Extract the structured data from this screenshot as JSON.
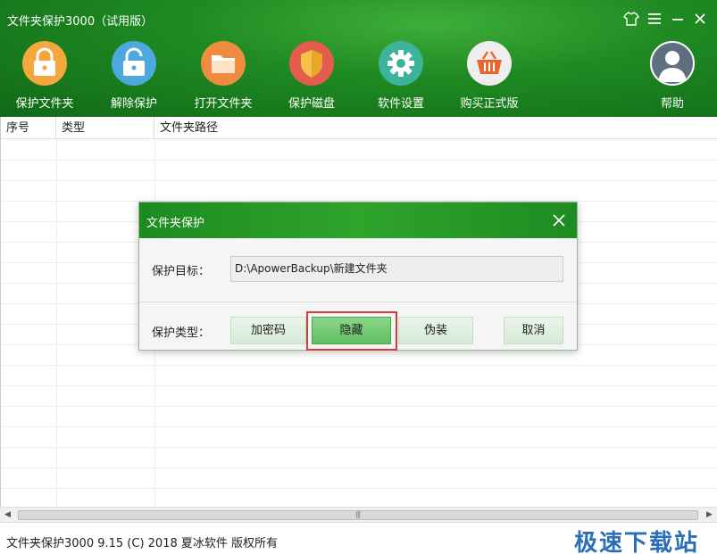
{
  "window": {
    "title": "文件夹保护3000（试用版）",
    "controls": [
      {
        "name": "skin",
        "glyph": "👕"
      },
      {
        "name": "menu",
        "glyph": "☰"
      },
      {
        "name": "minimize",
        "glyph": "—"
      },
      {
        "name": "close",
        "glyph": "✕"
      }
    ]
  },
  "toolbar": {
    "items": [
      {
        "label": "保护文件夹",
        "icon": "lock-icon",
        "color": "#f0a040"
      },
      {
        "label": "解除保护",
        "icon": "unlock-icon",
        "color": "#4aa3e0"
      },
      {
        "label": "打开文件夹",
        "icon": "folder-icon",
        "color": "#f08a3a"
      },
      {
        "label": "保护磁盘",
        "icon": "shield-icon",
        "color": "#e85a4a"
      },
      {
        "label": "软件设置",
        "icon": "gear-icon",
        "color": "#3fb59a"
      },
      {
        "label": "购买正式版",
        "icon": "basket-icon",
        "color": "#f0f0f0"
      },
      {
        "label": "帮助",
        "icon": "user-icon",
        "color": "#6a7a8a"
      }
    ]
  },
  "table": {
    "columns": [
      "序号",
      "类型",
      "文件夹路径"
    ],
    "rows": []
  },
  "dialog": {
    "title": "文件夹保护",
    "target_label": "保护目标：",
    "target_value": "D:\\ApowerBackup\\新建文件夹",
    "type_label": "保护类型：",
    "buttons": {
      "encrypt": "加密码",
      "hide": "隐藏",
      "disguise": "伪装",
      "cancel": "取消"
    },
    "selected": "hide"
  },
  "status": {
    "text": "文件夹保护3000 9.15 (C) 2018 夏冰软件 版权所有",
    "watermark": "极速下载站"
  }
}
